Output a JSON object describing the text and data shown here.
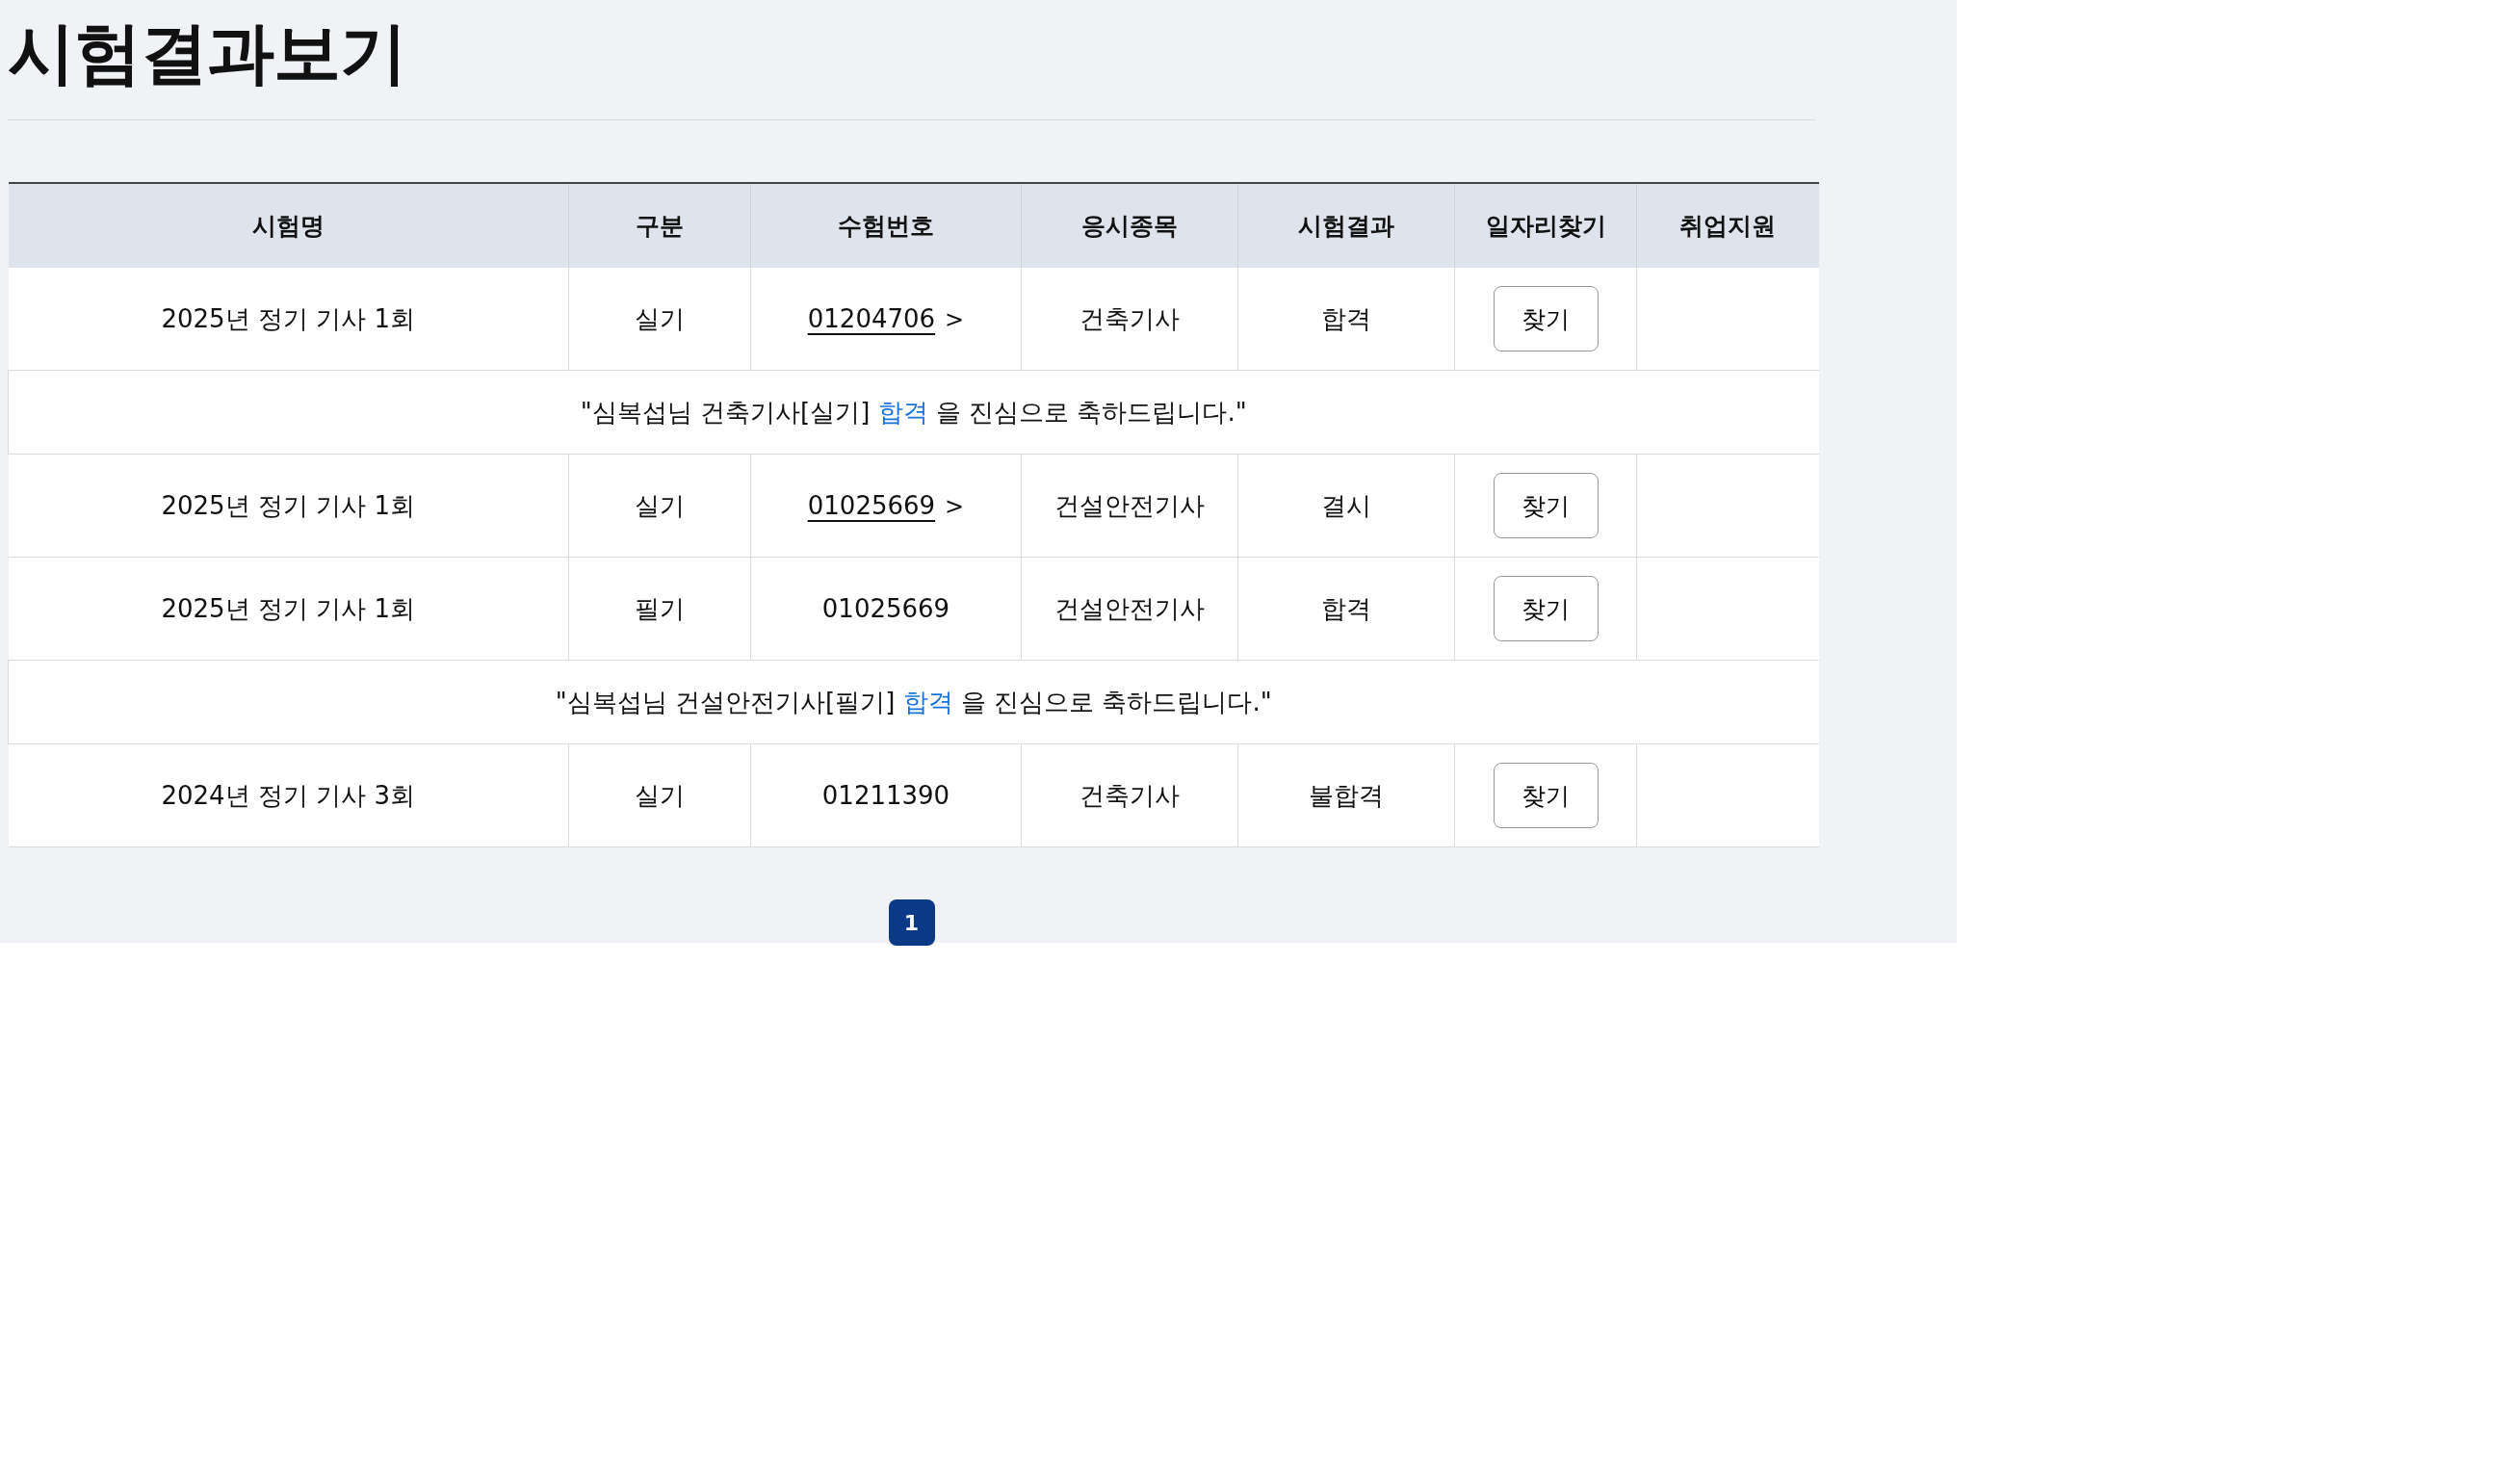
{
  "title": "시험결과보기",
  "table": {
    "columns": [
      "시험명",
      "구분",
      "수험번호",
      "응시종목",
      "시험결과",
      "일자리찾기",
      "취업지원"
    ],
    "rows": [
      {
        "kind": "exam",
        "name": "2025년 정기 기사 1회",
        "type": "실기",
        "number": "01204706",
        "linked": true,
        "chevron": ">",
        "subject": "건축기사",
        "result": "합격",
        "button": "찾기"
      },
      {
        "kind": "message",
        "before": "\"심복섭님 건축기사[실기]",
        "result": "합격",
        "after": "을 진심으로 축하드립니다.\""
      },
      {
        "kind": "exam",
        "name": "2025년 정기 기사 1회",
        "type": "실기",
        "number": "01025669",
        "linked": true,
        "chevron": ">",
        "subject": "건설안전기사",
        "result": "결시",
        "button": "찾기"
      },
      {
        "kind": "exam",
        "name": "2025년 정기 기사 1회",
        "type": "필기",
        "number": "01025669",
        "linked": false,
        "subject": "건설안전기사",
        "result": "합격",
        "button": "찾기"
      },
      {
        "kind": "message",
        "before": "\"심복섭님 건설안전기사[필기]",
        "result": "합격",
        "after": "을 진심으로 축하드립니다.\""
      },
      {
        "kind": "exam",
        "name": "2024년 정기 기사 3회",
        "type": "실기",
        "number": "01211390",
        "linked": false,
        "subject": "건축기사",
        "result": "불합격",
        "button": "찾기"
      }
    ]
  },
  "pagination": [
    {
      "label": "1",
      "selected": true
    }
  ]
}
